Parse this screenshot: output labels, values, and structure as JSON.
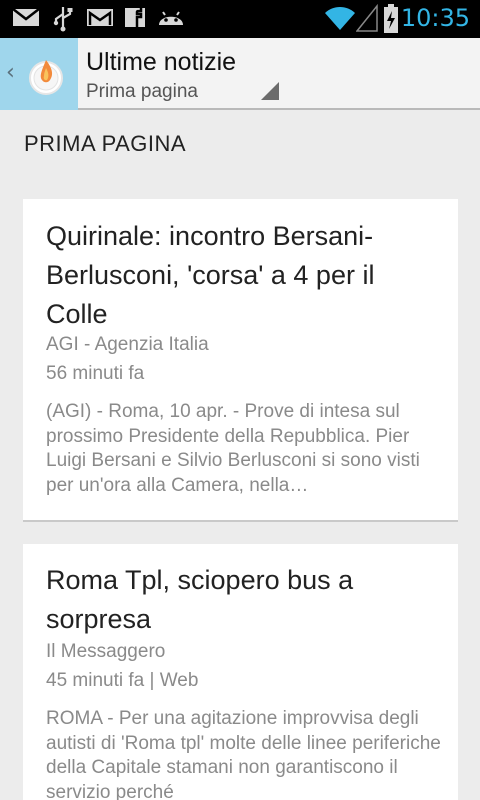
{
  "status_bar": {
    "time": "10:35",
    "icons": [
      "gmail-envelope-icon",
      "usb-icon",
      "gmail-icon",
      "facebook-icon",
      "android-icon",
      "wifi-icon",
      "signal-icon",
      "battery-charging-icon"
    ]
  },
  "action_bar": {
    "title": "Ultime notizie",
    "subtitle": "Prima pagina"
  },
  "section": {
    "title": "PRIMA PAGINA"
  },
  "articles": [
    {
      "title": "Quirinale: incontro Bersani-Berlusconi, 'corsa' a 4 per il Colle",
      "source": "AGI - Agenzia Italia",
      "time": "56 minuti fa",
      "snippet": "(AGI) - Roma, 10 apr. - Prove di intesa sul prossimo Presidente della Repubblica. Pier Luigi Bersani e Silvio Berlusconi si sono visti per un'ora alla Camera, nella…"
    },
    {
      "title": "Roma Tpl, sciopero bus a sorpresa",
      "source": "Il Messaggero",
      "time": "45 minuti fa | Web",
      "snippet": "ROMA - Per una agitazione improvvisa degli autisti di 'Roma tpl' molte delle linee periferiche della Capitale stamani non garantiscono il servizio perché"
    }
  ],
  "colors": {
    "status_clock": "#33b5e5",
    "home_button_bg": "#9fd6ec",
    "action_bar_bg": "#f3f3f3",
    "page_bg": "#ececec"
  }
}
